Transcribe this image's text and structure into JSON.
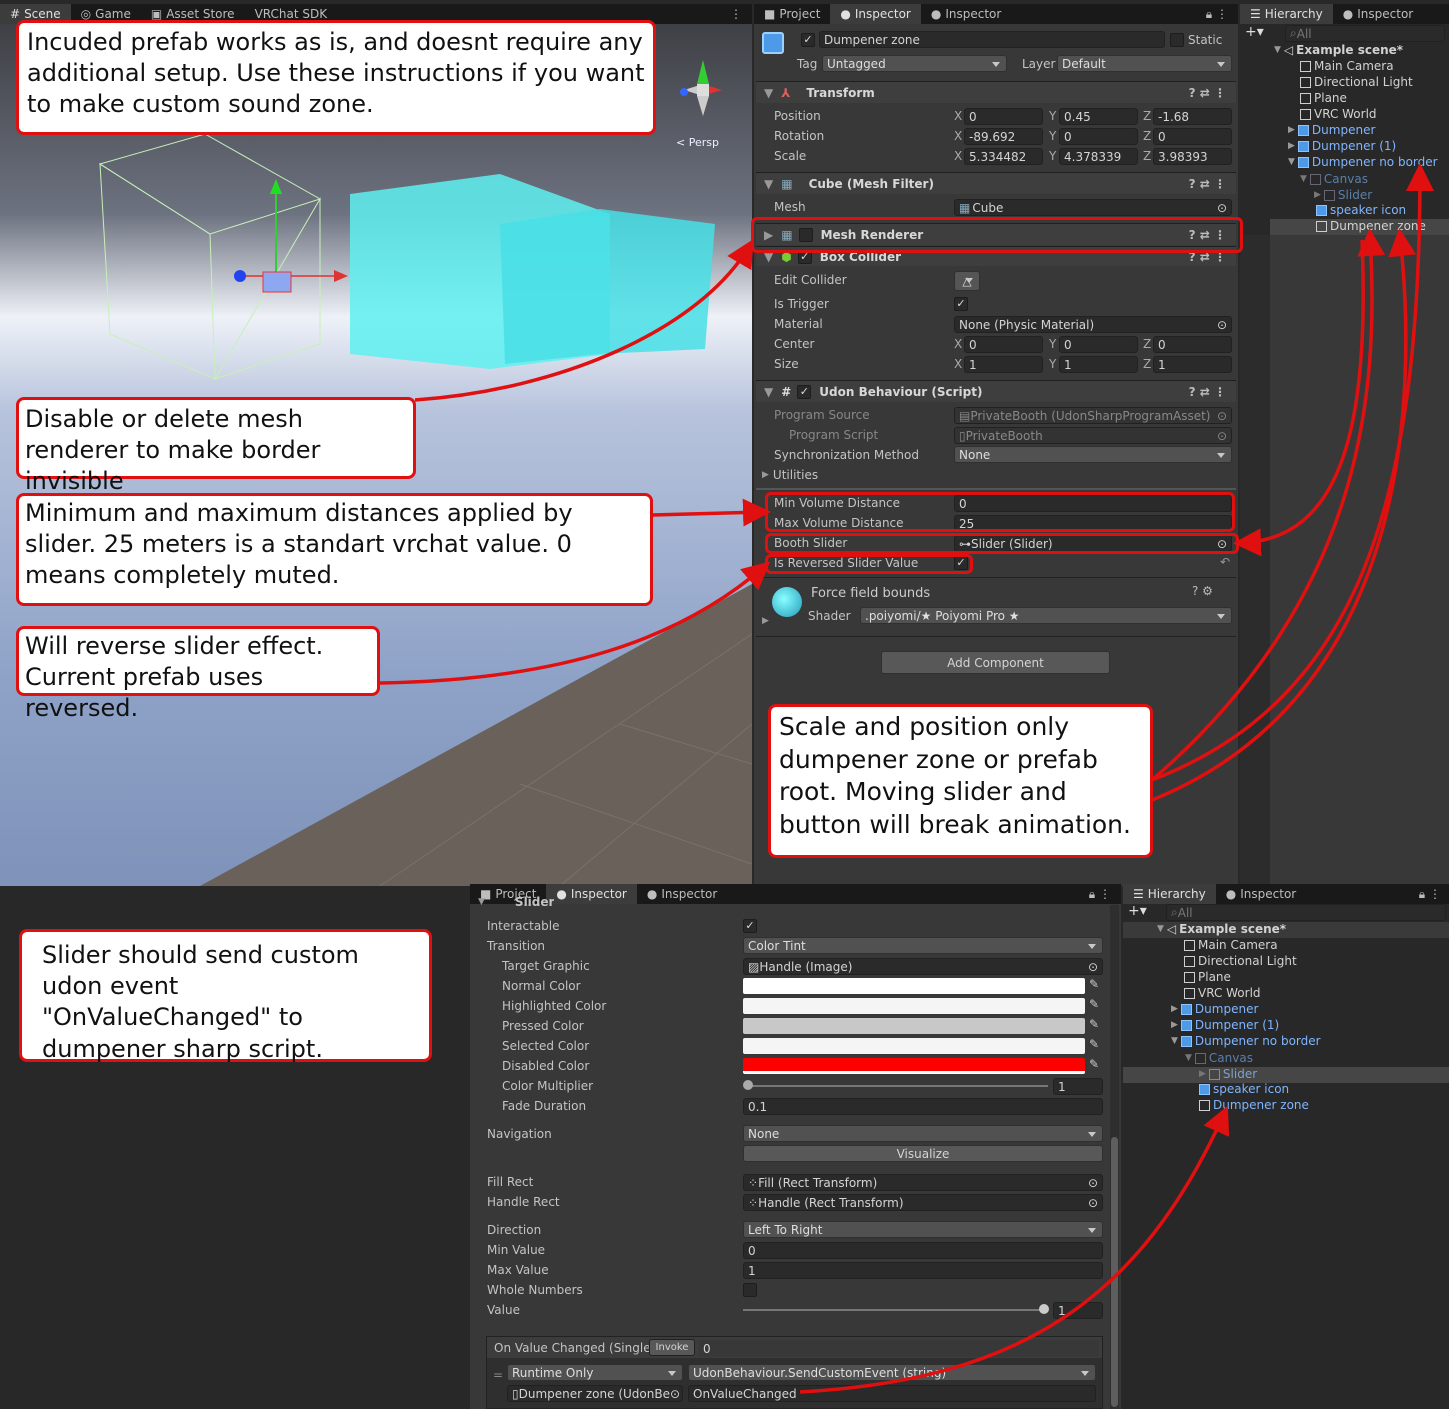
{
  "scene_tabs": [
    "Scene",
    "Game",
    "Asset Store",
    "VRChat SDK"
  ],
  "persp_label": "< Persp",
  "inspector": {
    "tabs": [
      "Project",
      "Inspector",
      "Inspector"
    ],
    "object_name": "Dumpener zone",
    "static_label": "Static",
    "tag_label": "Tag",
    "tag_value": "Untagged",
    "layer_label": "Layer",
    "layer_value": "Default",
    "transform": {
      "title": "Transform",
      "position_label": "Position",
      "rotation_label": "Rotation",
      "scale_label": "Scale",
      "position": [
        "0",
        "0.45",
        "-1.68"
      ],
      "rotation": [
        "-89.692",
        "0",
        "0"
      ],
      "scale": [
        "5.334482",
        "4.378339",
        "3.98393"
      ]
    },
    "mesh_filter": {
      "title": "Cube (Mesh Filter)",
      "mesh_label": "Mesh",
      "mesh_value": "Cube"
    },
    "mesh_renderer": {
      "title": "Mesh Renderer"
    },
    "box_collider": {
      "title": "Box Collider",
      "edit_label": "Edit Collider",
      "trigger_label": "Is Trigger",
      "material_label": "Material",
      "material_value": "None (Physic Material)",
      "center_label": "Center",
      "size_label": "Size",
      "center": [
        "0",
        "0",
        "0"
      ],
      "size": [
        "1",
        "1",
        "1"
      ]
    },
    "udon": {
      "title": "Udon Behaviour (Script)",
      "program_source_label": "Program Source",
      "program_source_value": "PrivateBooth (UdonSharpProgramAsset)",
      "program_script_label": "Program Script",
      "program_script_value": "PrivateBooth",
      "sync_label": "Synchronization Method",
      "sync_value": "None",
      "utilities_label": "Utilities",
      "min_label": "Min Volume Distance",
      "min_value": "0",
      "max_label": "Max Volume Distance",
      "max_value": "25",
      "slider_label": "Booth Slider",
      "slider_value": "Slider (Slider)",
      "reversed_label": "Is Reversed Slider Value"
    },
    "material": {
      "name": "Force field bounds",
      "shader_label": "Shader",
      "shader_value": ".poiyomi/★ Poiyomi Pro ★"
    },
    "add_component": "Add Component"
  },
  "hierarchy_top": {
    "tabs": [
      "Hierarchy",
      "Inspector"
    ],
    "search": "All",
    "scene": "Example scene*",
    "items": [
      "Main Camera",
      "Directional Light",
      "Plane",
      "VRC World",
      "Dumpener",
      "Dumpener (1)",
      "Dumpener no border",
      "Canvas",
      "Slider",
      "speaker icon",
      "Dumpener zone"
    ]
  },
  "slider_inspector": {
    "tabs": [
      "Project",
      "Inspector",
      "Inspector"
    ],
    "header": "Slider",
    "interactable_label": "Interactable",
    "transition_label": "Transition",
    "transition_value": "Color Tint",
    "target_graphic_label": "Target Graphic",
    "target_graphic_value": "Handle (Image)",
    "normal_label": "Normal Color",
    "highlighted_label": "Highlighted Color",
    "pressed_label": "Pressed Color",
    "selected_label": "Selected Color",
    "disabled_label": "Disabled Color",
    "multiplier_label": "Color Multiplier",
    "multiplier_value": "1",
    "fade_label": "Fade Duration",
    "fade_value": "0.1",
    "navigation_label": "Navigation",
    "navigation_value": "None",
    "visualize": "Visualize",
    "fill_label": "Fill Rect",
    "fill_value": "Fill (Rect Transform)",
    "handle_label": "Handle Rect",
    "handle_value": "Handle (Rect Transform)",
    "direction_label": "Direction",
    "direction_value": "Left To Right",
    "minv_label": "Min Value",
    "minv_value": "0",
    "maxv_label": "Max Value",
    "maxv_value": "1",
    "whole_label": "Whole Numbers",
    "value_label": "Value",
    "value_value": "1",
    "event_label": "On Value Changed (Single)",
    "invoke": "Invoke",
    "event_count": "0",
    "runtime": "Runtime Only",
    "function": "UdonBehaviour.SendCustomEvent (string)",
    "target": "Dumpener zone (UdonBe",
    "argument": "OnValueChanged"
  },
  "hierarchy_bottom": {
    "tabs": [
      "Hierarchy",
      "Inspector"
    ],
    "search": "All",
    "scene": "Example scene*",
    "items": [
      "Main Camera",
      "Directional Light",
      "Plane",
      "VRC World",
      "Dumpener",
      "Dumpener (1)",
      "Dumpener no border",
      "Canvas",
      "Slider",
      "speaker icon",
      "Dumpener zone"
    ]
  },
  "callouts": {
    "prefab": "Incuded prefab works as is, and doesnt require any additional setup. Use these instructions if you want to make custom sound zone.",
    "mesh": "Disable or delete mesh renderer to make border invisible",
    "distances": "Minimum and maximum distances applied by slider. 25 meters is a standart vrchat value. 0 means completely muted.",
    "reverse": "Will reverse slider effect. Current prefab uses reversed.",
    "scale": "Scale and position only dumpener zone or prefab root. Moving slider and button will break animation.",
    "slider_event": "Slider should send custom udon event \"OnValueChanged\" to dumpener sharp script."
  },
  "colors": {
    "accent": "#e01010",
    "selected_blue": "#7fb5ff",
    "disabled_color": "#ff0000"
  }
}
